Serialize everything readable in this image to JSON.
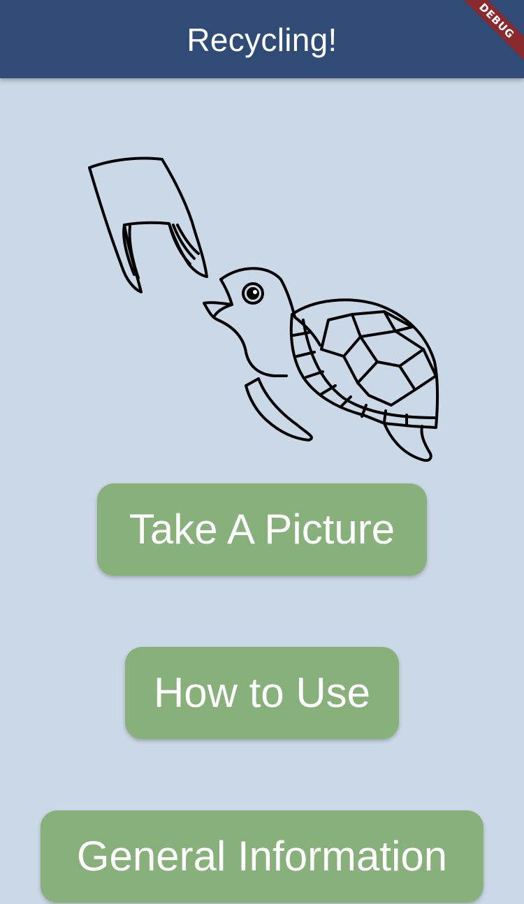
{
  "app_bar": {
    "title": "Recycling!",
    "background": "#2f4b76"
  },
  "debug_banner": {
    "label": "DEBUG"
  },
  "illustration": {
    "subject": "turtle-eating-plastic-bag-icon"
  },
  "buttons": {
    "take_picture": "Take A Picture",
    "how_to_use": "How to Use",
    "general_information": "General Information",
    "color": "#87b07a"
  },
  "page_background": "#cbd8e7"
}
